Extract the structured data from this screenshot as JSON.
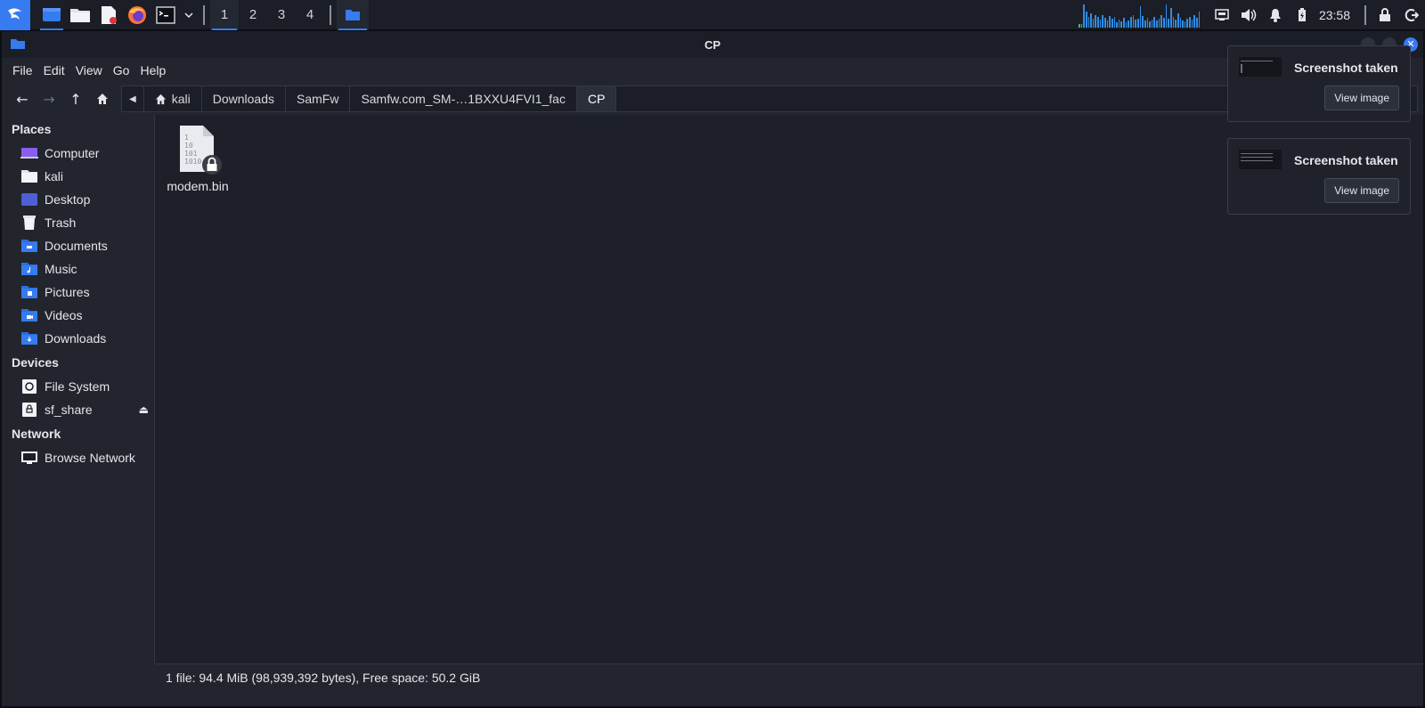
{
  "panel": {
    "workspaces": [
      "1",
      "2",
      "3",
      "4"
    ],
    "clock": "23:58"
  },
  "window": {
    "title": "CP",
    "menu": [
      "File",
      "Edit",
      "View",
      "Go",
      "Help"
    ],
    "breadcrumbs": [
      "kali",
      "Downloads",
      "SamFw",
      "Samfw.com_SM-…1BXXU4FVI1_fac",
      "CP"
    ]
  },
  "sidebar": {
    "places_header": "Places",
    "places": [
      {
        "label": "Computer",
        "icon": "computer-icon"
      },
      {
        "label": "kali",
        "icon": "home-folder-icon"
      },
      {
        "label": "Desktop",
        "icon": "desktop-icon"
      },
      {
        "label": "Trash",
        "icon": "trash-icon"
      },
      {
        "label": "Documents",
        "icon": "documents-folder-icon"
      },
      {
        "label": "Music",
        "icon": "music-folder-icon"
      },
      {
        "label": "Pictures",
        "icon": "pictures-folder-icon"
      },
      {
        "label": "Videos",
        "icon": "videos-folder-icon"
      },
      {
        "label": "Downloads",
        "icon": "downloads-folder-icon"
      }
    ],
    "devices_header": "Devices",
    "devices": [
      {
        "label": "File System",
        "icon": "drive-icon"
      },
      {
        "label": "sf_share",
        "icon": "network-drive-icon"
      }
    ],
    "network_header": "Network",
    "network": [
      {
        "label": "Browse Network",
        "icon": "network-icon"
      }
    ]
  },
  "files": [
    {
      "name": "modem.bin",
      "icon": "binary-file-locked-icon"
    }
  ],
  "status": "1 file: 94.4 MiB (98,939,392 bytes), Free space: 50.2 GiB",
  "notifications": [
    {
      "title": "Screenshot taken",
      "button": "View image"
    },
    {
      "title": "Screenshot taken",
      "button": "View image"
    }
  ],
  "colors": {
    "accent": "#367bf0",
    "panel_bg": "#1b1e26",
    "window_bg": "#22252e"
  }
}
